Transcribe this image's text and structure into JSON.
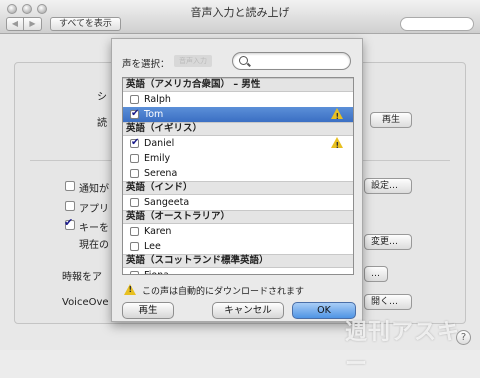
{
  "window": {
    "title": "音声入力と読み上げ",
    "show_all": "すべてを表示",
    "back_glyph": "◀",
    "forward_glyph": "▶"
  },
  "background": {
    "label_shi": "シ",
    "label_yomi": "読",
    "play_button": "再生",
    "notify_label": "通知が",
    "app_label": "アプリ",
    "key_label": "キーを",
    "current_label": "現在の",
    "time_label": "時報をア",
    "voiceover_label": "VoiceOve",
    "settings_button": "設定…",
    "change_button": "変更…",
    "open_button": "開く…",
    "ellipsis_button": "…",
    "help": "?"
  },
  "sheet": {
    "label": "声を選択：",
    "ghost_text": "音声入力",
    "search_placeholder": "",
    "groups": [
      {
        "header": "英語（アメリカ合衆国） – 男性",
        "items": [
          {
            "name": "Ralph",
            "checked": false,
            "selected": false,
            "warn": false
          },
          {
            "name": "Tom",
            "checked": true,
            "selected": true,
            "warn": true
          }
        ]
      },
      {
        "header": "英語（イギリス）",
        "items": [
          {
            "name": "Daniel",
            "checked": true,
            "selected": false,
            "warn": true
          },
          {
            "name": "Emily",
            "checked": false,
            "selected": false,
            "warn": false
          },
          {
            "name": "Serena",
            "checked": false,
            "selected": false,
            "warn": false
          }
        ]
      },
      {
        "header": "英語（インド）",
        "items": [
          {
            "name": "Sangeeta",
            "checked": false,
            "selected": false,
            "warn": false
          }
        ]
      },
      {
        "header": "英語（オーストラリア）",
        "items": [
          {
            "name": "Karen",
            "checked": false,
            "selected": false,
            "warn": false
          },
          {
            "name": "Lee",
            "checked": false,
            "selected": false,
            "warn": false
          }
        ]
      },
      {
        "header": "英語（スコットランド標準英語）",
        "items": [
          {
            "name": "Fiona",
            "checked": false,
            "selected": false,
            "warn": false
          }
        ]
      }
    ],
    "note": "この声は自動的にダウンロードされます",
    "play_button": "再生",
    "cancel_button": "キャンセル",
    "ok_button": "OK"
  },
  "watermark": "週刊アスキー",
  "colors": {
    "selection": "#3b6fc3",
    "warning": "#e8c020",
    "ok_button": "#4f94e4"
  }
}
